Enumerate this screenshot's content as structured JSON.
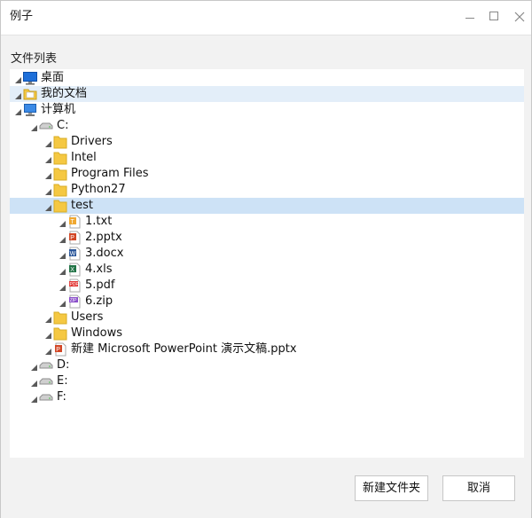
{
  "window": {
    "title": "例子"
  },
  "section_label": "文件列表",
  "tree": [
    {
      "label": "桌面",
      "icon": "desktop-icon",
      "depth": 0,
      "state": ""
    },
    {
      "label": "我的文档",
      "icon": "documents-folder-icon",
      "depth": 0,
      "state": "hover"
    },
    {
      "label": "计算机",
      "icon": "computer-icon",
      "depth": 0,
      "state": ""
    },
    {
      "label": "C:",
      "icon": "drive-icon",
      "depth": 1,
      "state": ""
    },
    {
      "label": "Drivers",
      "icon": "folder-icon",
      "depth": 2,
      "state": ""
    },
    {
      "label": "Intel",
      "icon": "folder-icon",
      "depth": 2,
      "state": ""
    },
    {
      "label": "Program Files",
      "icon": "folder-icon",
      "depth": 2,
      "state": ""
    },
    {
      "label": "Python27",
      "icon": "folder-icon",
      "depth": 2,
      "state": ""
    },
    {
      "label": "test",
      "icon": "folder-icon",
      "depth": 2,
      "state": "selected"
    },
    {
      "label": "1.txt",
      "icon": "txt-file-icon",
      "depth": 3,
      "state": ""
    },
    {
      "label": "2.pptx",
      "icon": "pptx-file-icon",
      "depth": 3,
      "state": ""
    },
    {
      "label": "3.docx",
      "icon": "docx-file-icon",
      "depth": 3,
      "state": ""
    },
    {
      "label": "4.xls",
      "icon": "xls-file-icon",
      "depth": 3,
      "state": ""
    },
    {
      "label": "5.pdf",
      "icon": "pdf-file-icon",
      "depth": 3,
      "state": ""
    },
    {
      "label": "6.zip",
      "icon": "zip-file-icon",
      "depth": 3,
      "state": ""
    },
    {
      "label": "Users",
      "icon": "folder-icon",
      "depth": 2,
      "state": ""
    },
    {
      "label": "Windows",
      "icon": "folder-icon",
      "depth": 2,
      "state": ""
    },
    {
      "label": "新建 Microsoft PowerPoint 演示文稿.pptx",
      "icon": "pptx-file-icon",
      "depth": 2,
      "state": ""
    },
    {
      "label": "D:",
      "icon": "drive-icon",
      "depth": 1,
      "state": ""
    },
    {
      "label": "E:",
      "icon": "drive-icon",
      "depth": 1,
      "state": ""
    },
    {
      "label": "F:",
      "icon": "drive-icon",
      "depth": 1,
      "state": ""
    }
  ],
  "buttons": {
    "new_folder": "新建文件夹",
    "cancel": "取消"
  },
  "colors": {
    "selection": "#cde2f6",
    "hover": "#e3eef9",
    "folder": "#f5c842"
  }
}
